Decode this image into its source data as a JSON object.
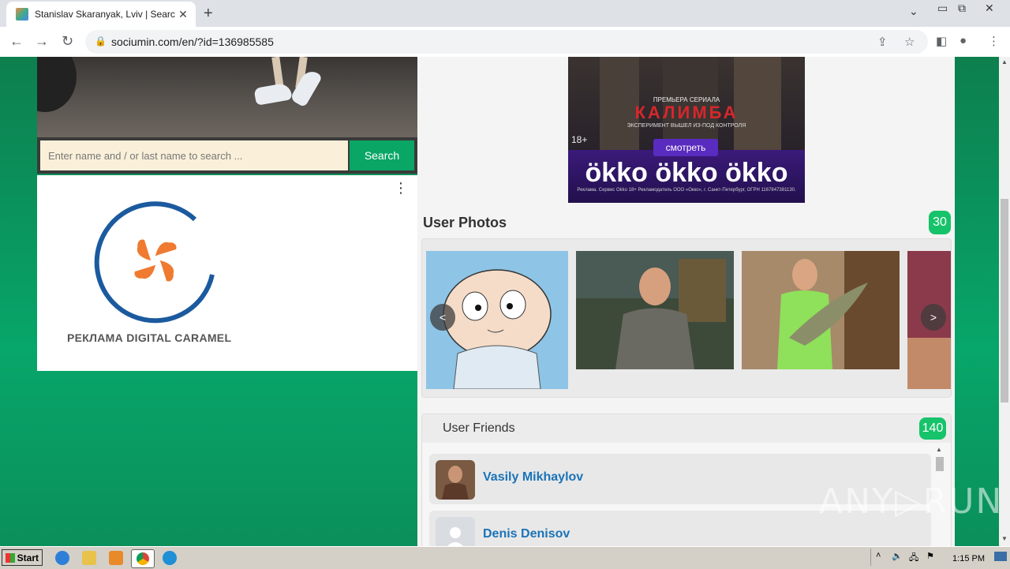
{
  "browser": {
    "tab_title": "Stanislav Skaranyak, Lviv | Search Ir",
    "tab_close": "✕",
    "new_tab": "+",
    "url": "sociumin.com/en/?id=136985585",
    "window_controls": [
      "▭",
      "⧉",
      "✕"
    ]
  },
  "search": {
    "placeholder": "Enter name and / or last name to search ...",
    "button_label": "Search"
  },
  "left_ad": {
    "menu": "⋮",
    "label": "РЕКЛАМА DIGITAL CARAMEL"
  },
  "banner": {
    "premiere": "ПРЕМЬЕРА СЕРИАЛА",
    "title": "КАЛИМБА",
    "subtitle": "ЭКСПЕРИМЕНТ ВЫШЕЛ ИЗ-ПОД КОНТРОЛЯ",
    "age": "18+",
    "watch": "смотреть",
    "brand": "ökko ökko ökko",
    "legal": "Реклама. Сервис Okko 18+ Рекламодатель ООО «Оккo», г. Санкт-Петербург, ОГРН 1167847381130."
  },
  "photos": {
    "heading": "User Photos",
    "count": "30",
    "prev": "<",
    "next": ">"
  },
  "friends": {
    "heading": "User Friends",
    "count": "140",
    "items": [
      {
        "name": "Vasily Mikhaylov"
      },
      {
        "name": "Denis Denisov"
      }
    ]
  },
  "watermark": "ANY▷RUN",
  "taskbar": {
    "start_label": "Start",
    "clock": "1:15 PM"
  }
}
